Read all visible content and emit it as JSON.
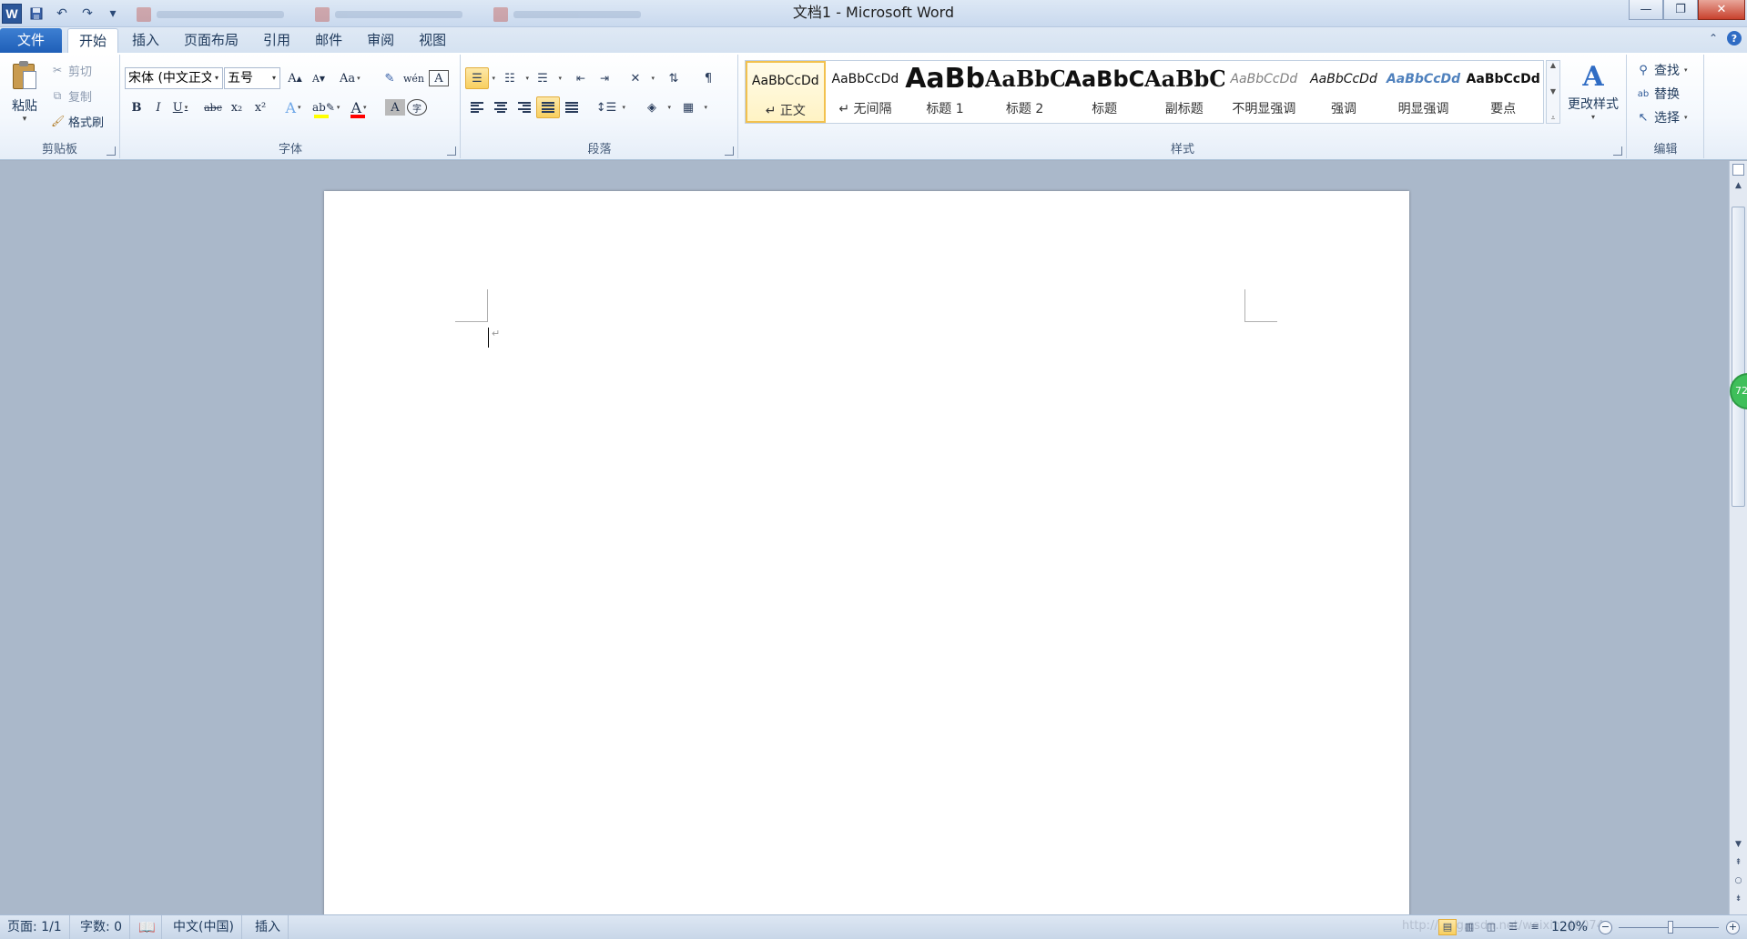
{
  "window": {
    "title": "文档1 - Microsoft Word",
    "app_logo": "W",
    "minimize": "—",
    "restore": "❐",
    "close": "✕"
  },
  "ribbon_tabs": [
    {
      "label": "文件"
    },
    {
      "label": "开始"
    },
    {
      "label": "插入"
    },
    {
      "label": "页面布局"
    },
    {
      "label": "引用"
    },
    {
      "label": "邮件"
    },
    {
      "label": "审阅"
    },
    {
      "label": "视图"
    }
  ],
  "clipboard": {
    "paste": "粘贴",
    "cut": "剪切",
    "copy": "复制",
    "format_painter": "格式刷",
    "group_label": "剪贴板"
  },
  "font": {
    "font_name": "宋体 (中文正文)",
    "font_size": "五号",
    "grow": "A",
    "shrink": "A",
    "change_case": "Aa",
    "bold": "B",
    "italic": "I",
    "underline": "U",
    "strike": "abc",
    "subscript": "x₂",
    "superscript": "x²",
    "text_effect": "A",
    "font_color": "A",
    "char_shading": "A",
    "enclose": "字",
    "pinyin": "wén",
    "clear": "A",
    "border": "A",
    "group_label": "字体",
    "highlight_color": "#ffff00",
    "font_color_value": "#ff0000"
  },
  "paragraph": {
    "group_label": "段落"
  },
  "styles": {
    "items": [
      {
        "sample": "AaBbCcDd",
        "name": "↵ 正文"
      },
      {
        "sample": "AaBbCcDd",
        "name": "↵ 无间隔"
      },
      {
        "sample": "AaBb",
        "name": "标题 1"
      },
      {
        "sample": "AaBbC",
        "name": "标题 2"
      },
      {
        "sample": "AaBbC",
        "name": "标题"
      },
      {
        "sample": "AaBbC",
        "name": "副标题"
      },
      {
        "sample": "AaBbCcDd",
        "name": "不明显强调"
      },
      {
        "sample": "AaBbCcDd",
        "name": "强调"
      },
      {
        "sample": "AaBbCcDd",
        "name": "明显强调"
      },
      {
        "sample": "AaBbCcDd",
        "name": "要点"
      }
    ],
    "change_styles": "更改样式",
    "group_label": "样式"
  },
  "editing": {
    "find": "查找",
    "replace": "替换",
    "select": "选择",
    "group_label": "编辑"
  },
  "status": {
    "page": "页面: 1/1",
    "words": "字数: 0",
    "language": "中文(中国)",
    "mode": "插入",
    "zoom": "120%",
    "zoom_minus": "−",
    "zoom_plus": "+"
  },
  "badge": {
    "value": "72"
  },
  "watermark": "http://blog.csdn.net/weixin_40074"
}
